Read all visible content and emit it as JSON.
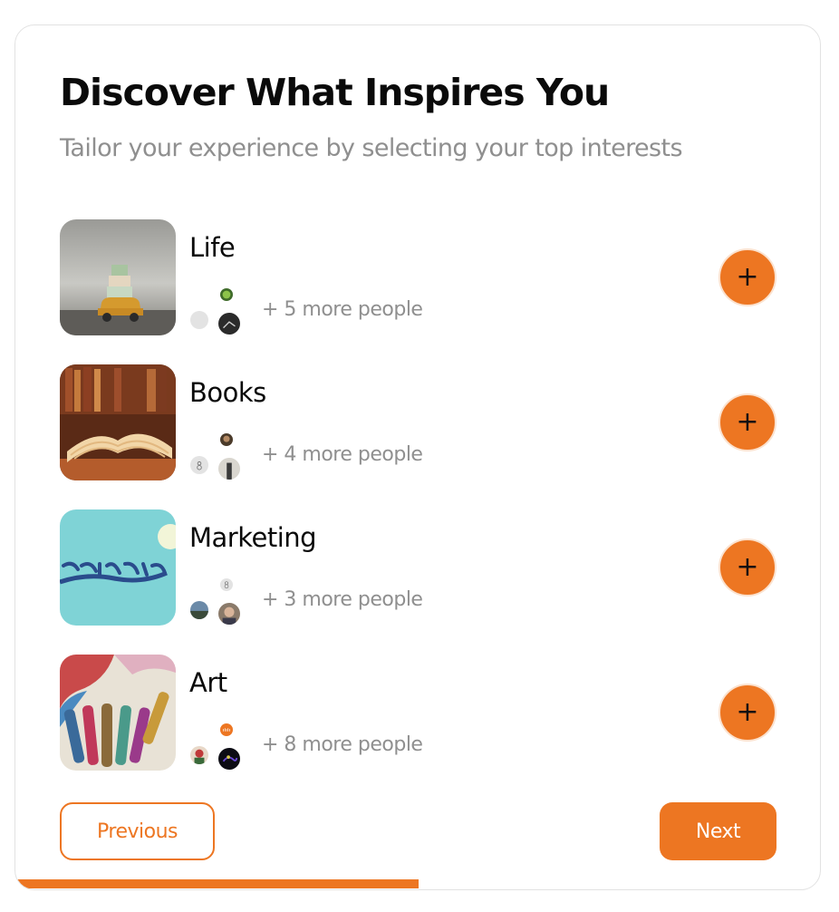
{
  "header": {
    "title": "Discover What Inspires You",
    "subtitle": "Tailor your experience by selecting your top interests"
  },
  "interests": [
    {
      "label": "Life",
      "more_text": "+ 5 more people",
      "add_symbol": "+",
      "thumb_icon": "toy-car-with-gifts-image"
    },
    {
      "label": "Books",
      "more_text": "+ 4 more people",
      "add_symbol": "+",
      "thumb_icon": "open-book-image"
    },
    {
      "label": "Marketing",
      "more_text": "+ 3 more people",
      "add_symbol": "+",
      "thumb_icon": "marketing-lightbulb-image"
    },
    {
      "label": "Art",
      "more_text": "+ 8 more people",
      "add_symbol": "+",
      "thumb_icon": "paint-brushes-image"
    }
  ],
  "footer": {
    "previous_label": "Previous",
    "next_label": "Next"
  },
  "progress": {
    "fraction": 0.5
  },
  "colors": {
    "accent": "#ed7622",
    "title": "#0a0a0a",
    "muted": "#8f8f8f",
    "border": "#e2e2e2"
  }
}
